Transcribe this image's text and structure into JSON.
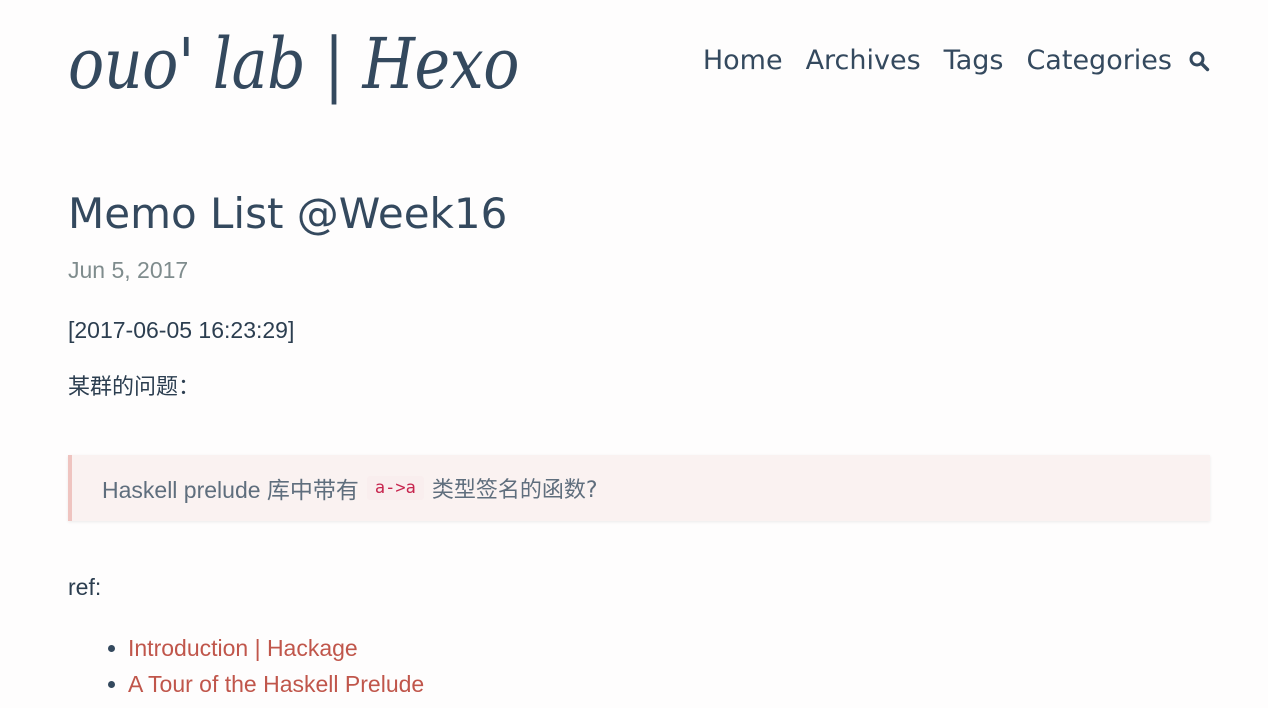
{
  "header": {
    "site_title": "ouo' lab | Hexo",
    "nav": [
      "Home",
      "Archives",
      "Tags",
      "Categories"
    ],
    "search_icon": "search-icon"
  },
  "post": {
    "title": "Memo List @Week16",
    "date": "Jun 5, 2017",
    "timestamp": "[2017-06-05 16:23:29]",
    "question_intro": "某群的问题：",
    "blockquote": {
      "before_code": "Haskell prelude 库中带有",
      "code": "a->a",
      "after_code": "类型签名的函数?"
    },
    "ref_label": "ref:",
    "refs": [
      "Introduction | Hackage",
      "A Tour of the Haskell Prelude"
    ]
  },
  "colors": {
    "text": "#34495e",
    "link": "#c0564b",
    "date": "#7f8c8d",
    "blockquote_bg": "#faf2f1",
    "blockquote_border": "#efc4c0",
    "code": "#c7254e"
  }
}
